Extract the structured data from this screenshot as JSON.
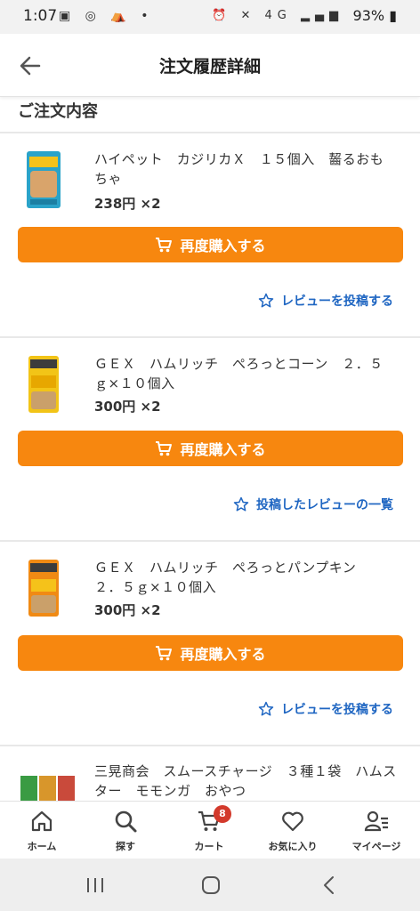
{
  "status_bar": {
    "time": "1:07",
    "battery": "93%",
    "network": "4G"
  },
  "header": {
    "title": "注文履歴詳細"
  },
  "section": {
    "title": "ご注文内容"
  },
  "items": [
    {
      "name": "ハイペット　カジリカＸ　１５個入　齧るおもちゃ",
      "price": "238円 ×2",
      "rebuy_label": "再度購入する",
      "review_label": "レビューを投稿する"
    },
    {
      "name": "ＧＥＸ　ハムリッチ　ぺろっとコーン　２．５ｇ×１０個入",
      "price": "300円 ×2",
      "rebuy_label": "再度購入する",
      "review_label": "投稿したレビューの一覧"
    },
    {
      "name": "ＧＥＸ　ハムリッチ　ぺろっとパンプキン　２．５ｇ×１０個入",
      "price": "300円 ×2",
      "rebuy_label": "再度購入する",
      "review_label": "レビューを投稿する"
    },
    {
      "name": "三晃商会　スムースチャージ　３種１袋　ハムスター　モモンガ　おやつ"
    }
  ],
  "bottom_nav": {
    "home": "ホーム",
    "search": "探す",
    "cart": "カート",
    "cart_badge": "8",
    "favorites": "お気に入り",
    "mypage": "マイページ"
  },
  "colors": {
    "accent": "#f7870f",
    "link": "#1f66c2",
    "badge": "#d33a2c"
  }
}
